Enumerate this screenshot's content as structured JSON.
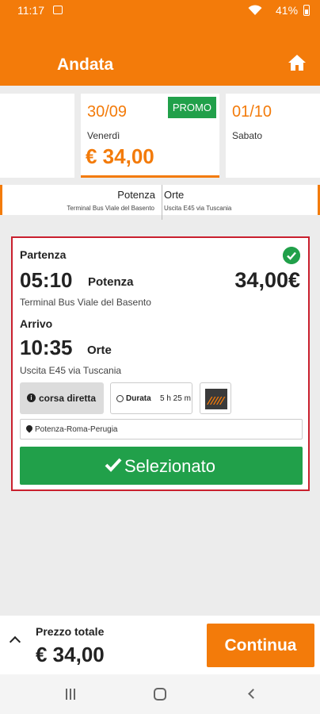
{
  "status_bar": {
    "time": "11:17",
    "battery": "41%"
  },
  "header": {
    "title": "Andata"
  },
  "dates": [
    {
      "date": "",
      "day": "",
      "price": ""
    },
    {
      "date": "30/09",
      "day": "Venerdì",
      "price": "€ 34,00",
      "badge": "PROMO",
      "selected": true
    },
    {
      "date": "01/10",
      "day": "Sabato",
      "price": ""
    }
  ],
  "route": {
    "from_city": "Potenza",
    "from_terminal": "Terminal Bus Viale del Basento",
    "to_city": "Orte",
    "to_terminal": "Uscita E45 via Tuscania"
  },
  "trip": {
    "departure_label": "Partenza",
    "departure_time": "05:10",
    "departure_city": "Potenza",
    "departure_terminal": "Terminal Bus Viale del Basento",
    "price": "34,00€",
    "arrival_label": "Arrivo",
    "arrival_time": "10:35",
    "arrival_city": "Orte",
    "arrival_terminal": "Uscita E45 via Tuscania",
    "direct_label": "corsa diretta",
    "duration_label": "Durata",
    "duration_value": "5 h 25 m",
    "route_name": "Potenza-Roma-Perugia",
    "selected_label": "Selezionato"
  },
  "footer": {
    "total_label": "Prezzo totale",
    "total_value": "€ 34,00",
    "continue_label": "Continua"
  },
  "colors": {
    "accent": "#f37b0a",
    "success": "#21a04a",
    "selected_border": "#c9202e"
  }
}
